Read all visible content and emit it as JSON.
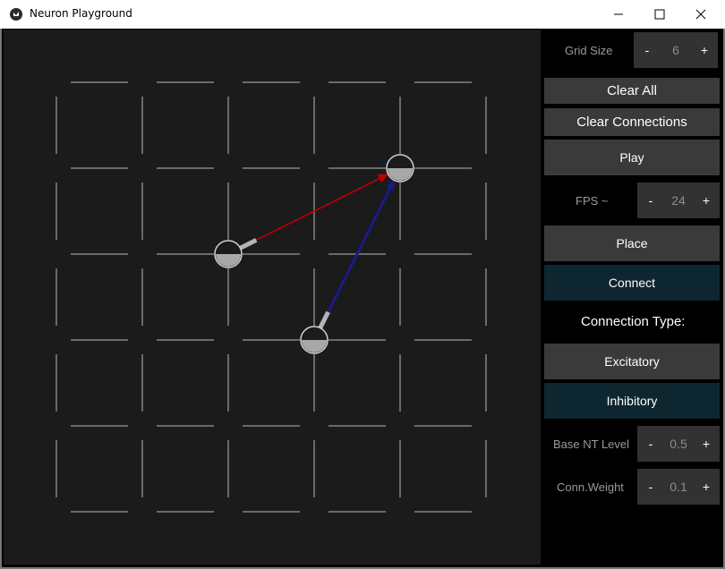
{
  "window": {
    "title": "Neuron Playground",
    "controls": [
      "minimize-icon",
      "maximize-icon",
      "close-icon"
    ]
  },
  "panel": {
    "grid_size": {
      "label": "Grid Size",
      "minus": "-",
      "value": "6",
      "plus": "+"
    },
    "clear_all": "Clear All",
    "clear_connections": "Clear Connections",
    "play": "Play",
    "fps": {
      "label": "FPS ~",
      "minus": "-",
      "value": "24",
      "plus": "+"
    },
    "place": "Place",
    "connect": "Connect",
    "connection_type_title": "Connection Type:",
    "excitatory": "Excitatory",
    "inhibitory": "Inhibitory",
    "base_nt": {
      "label": "Base NT Level",
      "minus": "-",
      "value": "0.5",
      "plus": "+"
    },
    "conn_weight": {
      "label": "Conn.Weight",
      "minus": "-",
      "value": "0.1",
      "plus": "+"
    }
  },
  "colors": {
    "canvas_bg": "#1b1b1b",
    "grid_line": "#6a6a6a",
    "excitatory_connection": "#c00000",
    "inhibitory_connection": "#1a1a8c",
    "selected_button_bg": "#0e2630",
    "button_bg": "#3a3a3a"
  },
  "grid": {
    "cells": 6,
    "neurons": [
      {
        "col": 2,
        "row": 2
      },
      {
        "col": 4,
        "row": 1
      },
      {
        "col": 3,
        "row": 3
      }
    ],
    "connections": [
      {
        "from": 0,
        "to": 1,
        "type": "excitatory"
      },
      {
        "from": 2,
        "to": 1,
        "type": "inhibitory"
      }
    ]
  }
}
